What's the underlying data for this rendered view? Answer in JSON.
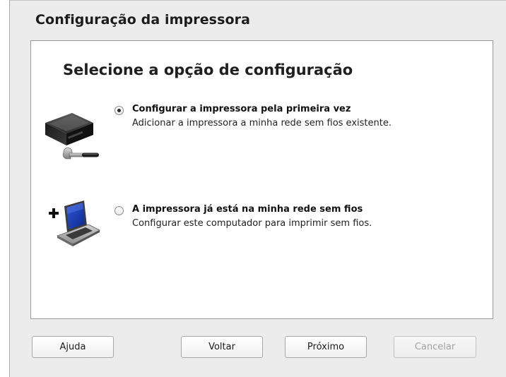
{
  "dialog": {
    "title": "Configuração da impressora",
    "heading": "Selecione a opção de configuração"
  },
  "options": [
    {
      "title": "Configurar a impressora pela primeira vez",
      "description": "Adicionar a impressora a minha rede sem fios existente.",
      "selected": true,
      "icon": "printer-wrench-icon"
    },
    {
      "title": "A impressora já está na minha rede sem fios",
      "description": "Configurar este computador para imprimir sem fios.",
      "selected": false,
      "icon": "add-laptop-icon"
    }
  ],
  "buttons": {
    "help": "Ajuda",
    "back": "Voltar",
    "next": "Próximo",
    "cancel": "Cancelar"
  },
  "colors": {
    "window_background": "#ececec",
    "panel_background": "#ffffff",
    "disabled_text": "#a2a2a2"
  }
}
